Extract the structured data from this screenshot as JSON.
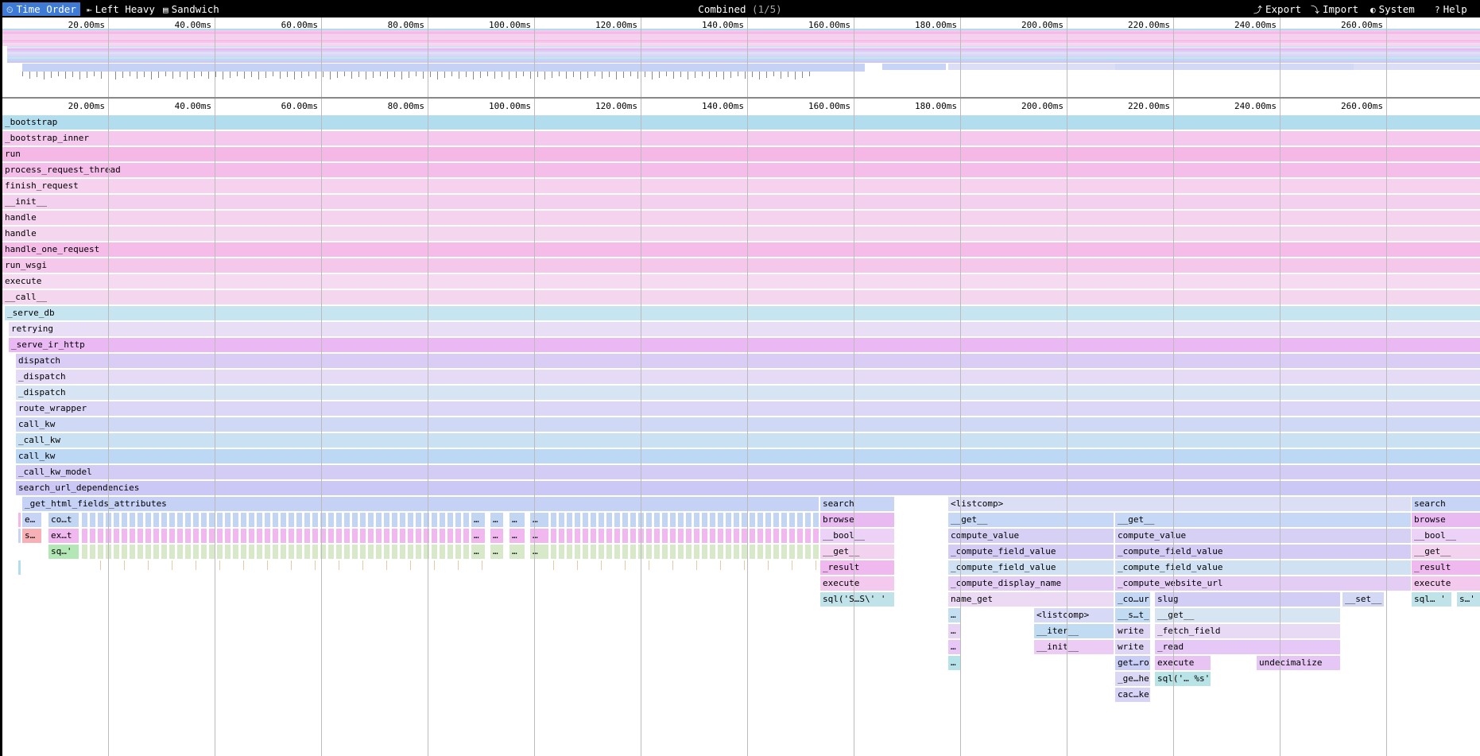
{
  "toolbar": {
    "tabs": [
      {
        "label": "Time Order",
        "icon": "time-order-icon"
      },
      {
        "label": "Left Heavy",
        "icon": "left-heavy-icon"
      },
      {
        "label": "Sandwich",
        "icon": "sandwich-icon"
      }
    ],
    "title": "Combined",
    "title_index": "(1/5)",
    "actions": [
      {
        "label": "Export",
        "icon": "export-icon"
      },
      {
        "label": "Import",
        "icon": "import-icon"
      },
      {
        "label": "System",
        "icon": "system-icon"
      },
      {
        "label": "Help",
        "icon": "help-icon"
      }
    ]
  },
  "axis": {
    "ticks": [
      "20.00ms",
      "40.00ms",
      "60.00ms",
      "80.00ms",
      "100.00ms",
      "120.00ms",
      "140.00ms",
      "160.00ms",
      "180.00ms",
      "200.00ms",
      "220.00ms",
      "240.00ms",
      "260.00ms"
    ]
  },
  "colors": {
    "accent": "#3e7bd6"
  },
  "stack_rows": [
    {
      "label": "_bootstrap",
      "color": "#b2ddef"
    },
    {
      "label": "_bootstrap_inner",
      "color": "#f5c9ee"
    },
    {
      "label": "run",
      "color": "#f5b8e6"
    },
    {
      "label": "process_request_thread",
      "color": "#f5bde9"
    },
    {
      "label": "finish_request",
      "color": "#f6d2ee"
    },
    {
      "label": "__init__",
      "color": "#f4d0ef"
    },
    {
      "label": "handle",
      "color": "#f5d2ee"
    },
    {
      "label": "handle",
      "color": "#f5d6ef"
    },
    {
      "label": "handle_one_request",
      "color": "#f5bbe9"
    },
    {
      "label": "run_wsgi",
      "color": "#f5c7ea"
    },
    {
      "label": "execute",
      "color": "#f5daf1"
    },
    {
      "label": "__call__",
      "color": "#f5d6ef"
    },
    {
      "label": "_serve_db",
      "color": "#c6e5f1"
    },
    {
      "label": "retrying",
      "color": "#e8dff7"
    },
    {
      "label": "_serve_ir_http",
      "color": "#eab9f3"
    },
    {
      "label": "dispatch",
      "color": "#d9cdf6"
    },
    {
      "label": "_dispatch",
      "color": "#e6dbf6"
    },
    {
      "label": "_dispatch",
      "color": "#d6e4f4"
    },
    {
      "label": "route_wrapper",
      "color": "#dcd7f6"
    },
    {
      "label": "call_kw",
      "color": "#cfd9f5"
    },
    {
      "label": "_call_kw",
      "color": "#c9e1f2"
    },
    {
      "label": "call_kw",
      "color": "#bcd8f4"
    },
    {
      "label": "_call_kw_model",
      "color": "#d3cdf5"
    },
    {
      "label": "search_url_dependencies",
      "color": "#ccc8f5"
    }
  ],
  "detail_frames": [
    {
      "label": "_get_html_fields_attributes",
      "color": "#c6d1f6"
    },
    {
      "label": "e…",
      "color": "#c8d4f5"
    },
    {
      "label": "co…t",
      "color": "#c2d6f3"
    },
    {
      "label": "s…",
      "color": "#f6b0b6"
    },
    {
      "label": "ex…t",
      "color": "#f1b7ef"
    },
    {
      "label": "sq…'",
      "color": "#b3e8b6"
    },
    {
      "label": "…",
      "color": "#c2d6f3"
    },
    {
      "label": "…",
      "color": "#c2d6f3"
    },
    {
      "label": "…",
      "color": "#c2d6f3"
    },
    {
      "label": "…",
      "color": "#c2d6f3"
    },
    {
      "label": "…",
      "color": "#f1b7ef"
    },
    {
      "label": "…",
      "color": "#f1b7ef"
    },
    {
      "label": "…",
      "color": "#f1b7ef"
    },
    {
      "label": "…",
      "color": "#f1b7ef"
    },
    {
      "label": "…",
      "color": "#d7e9c8"
    },
    {
      "label": "…",
      "color": "#d7e9c8"
    },
    {
      "label": "…",
      "color": "#d7e9c8"
    },
    {
      "label": "…",
      "color": "#d7e9c8"
    },
    {
      "label": "search",
      "color": "#c8d4f5"
    },
    {
      "label": "browse",
      "color": "#e9b9f2"
    },
    {
      "label": "__bool__",
      "color": "#ecd2f6"
    },
    {
      "label": "__get__",
      "color": "#f3d2ef"
    },
    {
      "label": "_result",
      "color": "#efb8ee"
    },
    {
      "label": "execute",
      "color": "#f3c9ee"
    },
    {
      "label": "sql('S…S\\'  '",
      "color": "#c0e3ea"
    },
    {
      "label": "<listcomp>",
      "color": "#dcdef6"
    },
    {
      "label": "__get__",
      "color": "#c6d8f5"
    },
    {
      "label": "compute_value",
      "color": "#d7d0f5"
    },
    {
      "label": "_compute_field_value",
      "color": "#d4ccf5"
    },
    {
      "label": "_compute_field_value",
      "color": "#cfe1f3"
    },
    {
      "label": "_compute_display_name",
      "color": "#e4cdf5"
    },
    {
      "label": "name_get",
      "color": "#ecd9f4"
    },
    {
      "label": "…",
      "color": "#c5dff2"
    },
    {
      "label": "…",
      "color": "#e9d3f5"
    },
    {
      "label": "…",
      "color": "#e8c6f5"
    },
    {
      "label": "…",
      "color": "#b6e3ea"
    },
    {
      "label": "<listcomp>",
      "color": "#d8d9f6"
    },
    {
      "label": "__iter__",
      "color": "#c0dbf2"
    },
    {
      "label": "__init__",
      "color": "#ecccf5"
    },
    {
      "label": "__get__",
      "color": "#c6d8f5"
    },
    {
      "label": "compute_value",
      "color": "#d7d0f5"
    },
    {
      "label": "_compute_field_value",
      "color": "#d4ccf5"
    },
    {
      "label": "_compute_field_value",
      "color": "#cfe1f3"
    },
    {
      "label": "_compute_website_url",
      "color": "#e4cdf5"
    },
    {
      "label": "_co…ur",
      "color": "#c3d7f4"
    },
    {
      "label": "slug",
      "color": "#d2cdf5"
    },
    {
      "label": "__s…t_",
      "color": "#c1dbf2"
    },
    {
      "label": "__get__",
      "color": "#d7e5f3"
    },
    {
      "label": "write",
      "color": "#dfd6f5"
    },
    {
      "label": "_fetch_field",
      "color": "#e8daf5"
    },
    {
      "label": "write",
      "color": "#dfd6f5"
    },
    {
      "label": "_read",
      "color": "#e5c8f5"
    },
    {
      "label": "get…ro",
      "color": "#c8cef5"
    },
    {
      "label": "execute",
      "color": "#e8c4f3"
    },
    {
      "label": "undecimalize",
      "color": "#e6c6f5"
    },
    {
      "label": "_ge…he",
      "color": "#dad8f5"
    },
    {
      "label": "sql('… %s'",
      "color": "#b8e4e8"
    },
    {
      "label": "cac…ke",
      "color": "#d7d3f6"
    },
    {
      "label": "__set__",
      "color": "#d3d9f5"
    },
    {
      "label": "search",
      "color": "#c8d4f5"
    },
    {
      "label": "browse",
      "color": "#e9b9f2"
    },
    {
      "label": "__bool__",
      "color": "#ecd2f6"
    },
    {
      "label": "__get__",
      "color": "#f3d2ef"
    },
    {
      "label": "_result",
      "color": "#efb8ee"
    },
    {
      "label": "execute",
      "color": "#f3c9ee"
    },
    {
      "label": "sql…  '",
      "color": "#c0e3ea"
    },
    {
      "label": "s…'",
      "color": "#c0e3ea"
    }
  ]
}
